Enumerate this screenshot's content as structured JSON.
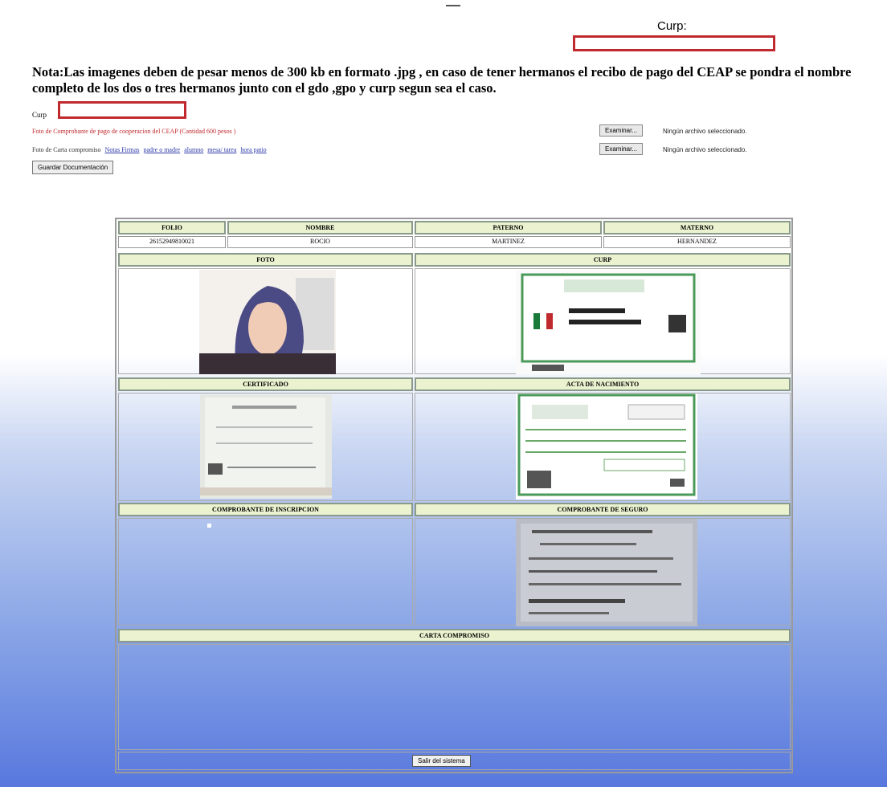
{
  "header": {
    "curp_label": "Curp:",
    "nota": "Nota:Las imagenes deben de pesar menos de 300 kb en formato .jpg , en caso de tener hermanos el recibo de pago del CEAP se pondra el nombre completo de los dos o tres hermanos junto con el gdo ,gpo y curp segun sea el caso."
  },
  "form": {
    "curp_label": "Curp",
    "foto_comprobante_label": "Foto de Comprobante de pago de cooperacion del CEAP (Cantidad 600 pesos )",
    "foto_carta_label": "Foto de Carta compromiso",
    "carta_links": [
      "Notas Firmas",
      "padre o madre",
      "alumno",
      "mesa/ tarea",
      "hora patio"
    ],
    "examinar_label": "Examinar...",
    "no_file_text": "Ningún archivo seleccionado.",
    "guardar_label": "Guardar Documentación"
  },
  "table": {
    "headers": [
      "FOLIO",
      "NOMBRE",
      "PATERNO",
      "MATERNO"
    ],
    "values": [
      "26152949810021",
      "ROCIO",
      "MARTINEZ",
      "HERNANDEZ"
    ],
    "section_titles": {
      "foto": "FOTO",
      "curp": "CURP",
      "certificado": "CERTIFICADO",
      "acta": "ACTA DE NACIMIENTO",
      "comprobante_inscripcion": "COMPROBANTE DE INSCRIPCION",
      "comprobante_seguro": "COMPROBANTE DE SEGURO",
      "carta_compromiso": "CARTA COMPROMISO"
    }
  },
  "footer": {
    "salir_label": "Salir del sistema"
  },
  "colors": {
    "header_cell_bg": "#eaf2cf",
    "field_border": "#c0292e",
    "gradient_bottom": "#5878de"
  }
}
